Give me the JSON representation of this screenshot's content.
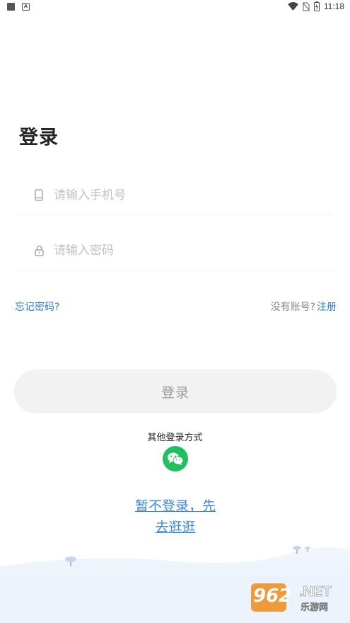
{
  "status_bar": {
    "time": "11:18",
    "icons": [
      "square-notification-icon",
      "a-notification-icon",
      "wifi-icon",
      "no-sim-icon",
      "battery-charging-icon"
    ]
  },
  "login": {
    "title": "登录",
    "phone_placeholder": "请输入手机号",
    "password_placeholder": "请输入密码",
    "forgot_password": "忘记密码?",
    "no_account": "没有账号?",
    "register": "注册",
    "login_button": "登录",
    "other_login": "其他登录方式",
    "skip_line1": "暂不登录，先",
    "skip_line2": "去逛逛"
  },
  "watermark": {
    "number": "962",
    "suffix": ".NET",
    "caption": "乐游网"
  },
  "colors": {
    "link": "#2f7ee0",
    "wechat": "#22bf5e",
    "button_bg": "#f2f2f2",
    "watermark_orange": "#f08a1c"
  }
}
